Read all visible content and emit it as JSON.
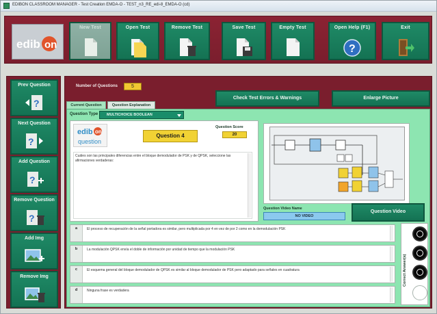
{
  "window": {
    "title": "EDIBON CLASSROOM MANAGER - Test Creation EMDA-O - TEST_n3_RE_edi-8_EMDA-O (cd)"
  },
  "logo": {
    "text": "edibon"
  },
  "toolbar": {
    "items": [
      {
        "label": "New Test",
        "icon": "new-test-icon",
        "enabled": false
      },
      {
        "label": "Open Test",
        "icon": "open-test-icon",
        "enabled": true
      },
      {
        "label": "Remove Test",
        "icon": "remove-test-icon",
        "enabled": true
      },
      {
        "label": "Save Test",
        "icon": "save-test-icon",
        "enabled": true
      },
      {
        "label": "Empty Test",
        "icon": "empty-test-icon",
        "enabled": true
      },
      {
        "label": "Open Help (F1)",
        "icon": "help-icon",
        "enabled": true
      },
      {
        "label": "Exit",
        "icon": "exit-icon",
        "enabled": true
      }
    ]
  },
  "sidebar": {
    "items": [
      {
        "label": "Prev Question",
        "icon": "prev-question-icon"
      },
      {
        "label": "Next Question",
        "icon": "next-question-icon"
      },
      {
        "label": "Add Question",
        "icon": "add-question-icon"
      },
      {
        "label": "Remove Question",
        "icon": "remove-question-icon"
      },
      {
        "label": "Add Img",
        "icon": "add-image-icon"
      },
      {
        "label": "Remove Img",
        "icon": "remove-image-icon"
      }
    ]
  },
  "main": {
    "number_of_questions_label": "Number of Questions",
    "number_of_questions": "5",
    "check_button": "Check Test Errors & Warnings",
    "enlarge_button": "Enlarge Picture",
    "tabs": [
      {
        "label": "Current Question",
        "active": true
      },
      {
        "label": "Question Explanation",
        "active": false
      }
    ],
    "question_type_label": "Question Type",
    "question_type_value": "MULTICHOICE BOOLEAN",
    "question_logo_line1": "edibon",
    "question_logo_line2": "question",
    "question_number": "Question 4",
    "question_score_label": "Question Score",
    "question_score": "20",
    "question_text": "Cuáles son las principales diferencias entre el bloque demodulador de PSK y de QPSK, seleccione las afirmaciones verdaderas:",
    "video_name_label": "Question Video Name",
    "video_name": "NO VIDEO",
    "video_button": "Question Video",
    "correct_label": "Correct Answer(s)",
    "answers": [
      {
        "letter": "a",
        "text": "El proceso de recuperación de la señal portadora es similar, pero multiplicada por 4 en vez de por 2 como en la demodulación PSK",
        "correct": true
      },
      {
        "letter": "b",
        "text": "La modulación QPSK envía el doble de información por unidad de tiempo que la modulación PSK",
        "correct": true
      },
      {
        "letter": "c",
        "text": "El esquema general del bloque demodulador de QPSK es similar al bloque demodulador de PSK pero adaptado para señales en cuadratura",
        "correct": true
      },
      {
        "letter": "d",
        "text": "Ninguna frase es verdadera",
        "correct": false
      }
    ]
  },
  "colors": {
    "frame": "#7a1e2d",
    "button": "#147253",
    "panel": "#8de5b1",
    "highlight": "#f1d234",
    "video_name": "#8bc9ee"
  }
}
